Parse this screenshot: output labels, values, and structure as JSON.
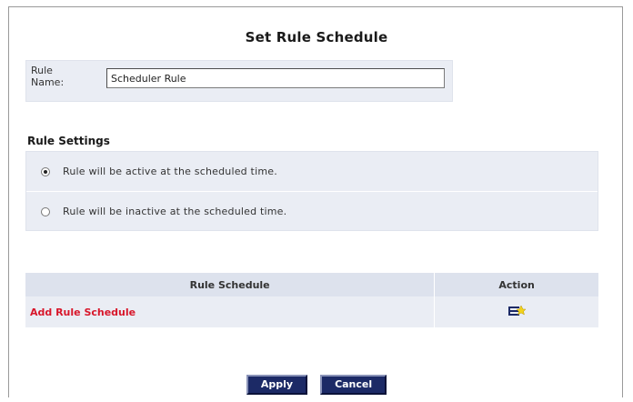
{
  "title": "Set Rule Schedule",
  "rule_name": {
    "label": "Rule Name:",
    "value": "Scheduler Rule"
  },
  "settings": {
    "heading": "Rule Settings",
    "options": [
      {
        "label": "Rule will be active at the scheduled time.",
        "checked": true
      },
      {
        "label": "Rule will be inactive at the scheduled time.",
        "checked": false
      }
    ]
  },
  "schedule_table": {
    "headers": [
      "Rule Schedule",
      "Action"
    ],
    "add_link": "Add Rule Schedule",
    "action_icon": "add-schedule-icon"
  },
  "buttons": {
    "apply": "Apply",
    "cancel": "Cancel"
  },
  "colors": {
    "link_red": "#d8162a",
    "button_navy": "#1c2a66",
    "panel_bg": "#eaedf4"
  }
}
